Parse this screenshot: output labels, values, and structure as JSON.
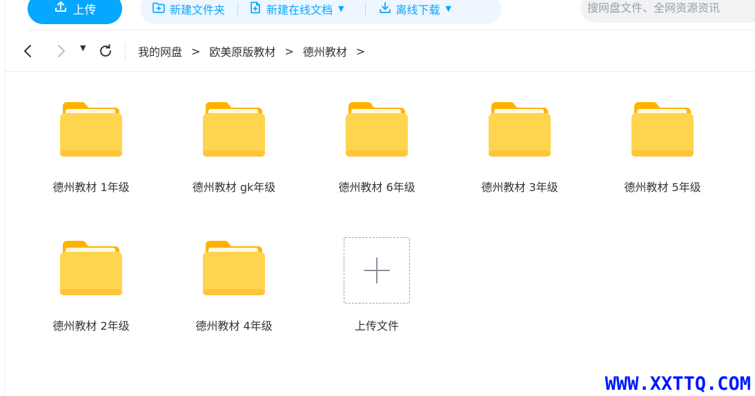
{
  "toolbar": {
    "upload_label": "上传",
    "new_folder_label": "新建文件夹",
    "new_online_doc_label": "新建在线文档",
    "offline_download_label": "离线下载",
    "caret": "▼",
    "search_placeholder": "搜网盘文件、全网资源资讯"
  },
  "nav": {
    "dropdown_caret": "▼",
    "arrow": ">",
    "breadcrumbs": [
      "我的网盘",
      "欧美原版教材",
      "德州教材"
    ]
  },
  "files": [
    {
      "name": "德州教材 1年级",
      "icon": "folder-icon"
    },
    {
      "name": "德州教材 gk年级",
      "icon": "folder-icon"
    },
    {
      "name": "德州教材 6年级",
      "icon": "folder-icon"
    },
    {
      "name": "德州教材 3年级",
      "icon": "folder-icon"
    },
    {
      "name": "德州教材 5年级",
      "icon": "folder-icon"
    },
    {
      "name": "德州教材 2年级",
      "icon": "folder-icon"
    },
    {
      "name": "德州教材 4年级",
      "icon": "folder-icon"
    }
  ],
  "upload_tile": {
    "label": "上传文件"
  },
  "watermark": "WWW.XXTTQ.COM",
  "colors": {
    "accent": "#06a7ff",
    "folder_front": "#ffd54f",
    "folder_back": "#ffb300"
  }
}
